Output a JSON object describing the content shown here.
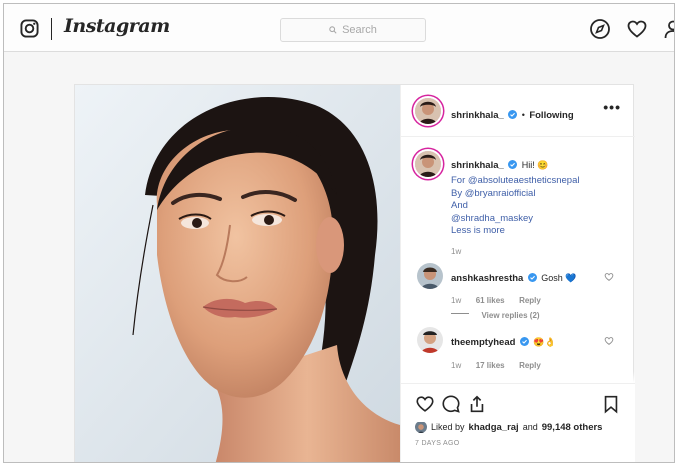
{
  "nav": {
    "logo_text": "Instagram",
    "search_placeholder": "Search",
    "icons": [
      "instagram-logo-icon",
      "search-icon",
      "compass-icon",
      "heart-icon",
      "profile-icon"
    ]
  },
  "post": {
    "author": "shrinkhala_",
    "follow_status": "Following",
    "more": "•••",
    "caption": {
      "username": "shrinkhala_",
      "text": "Hii! 😊",
      "lines": [
        "For @absoluteaestheticsnepal",
        "By @bryanraiofficial",
        "And",
        "@shradha_maskey",
        "Less is more"
      ],
      "time": "1w"
    },
    "comments": [
      {
        "username": "anshkashrestha",
        "text": "Gosh 💙",
        "time": "1w",
        "likes": "61 likes",
        "reply": "Reply",
        "view_replies": "View replies (2)"
      },
      {
        "username": "theemptyhead",
        "text": "😍👌",
        "time": "1w",
        "likes": "17 likes",
        "reply": "Reply"
      }
    ],
    "likes": {
      "prefix": "Liked by",
      "user": "khadga_raj",
      "conj": "and",
      "others": "99,148 others"
    },
    "posted": "7 DAYS AGO"
  },
  "colors": {
    "link": "#3f5fa8",
    "verified": "#3897f0",
    "story_ring": "#d6249f"
  }
}
